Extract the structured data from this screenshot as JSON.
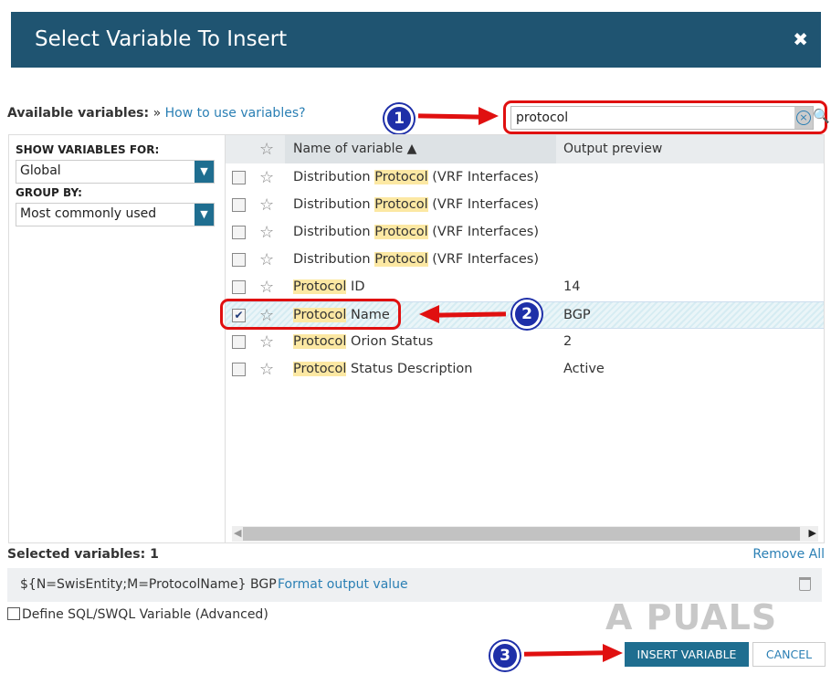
{
  "dialog": {
    "title": "Select Variable To Insert",
    "close_glyph": "✖"
  },
  "available": {
    "label": "Available variables:",
    "sep": "»",
    "help_link": "How to use variables?"
  },
  "search": {
    "value": "protocol",
    "clear_glyph": "×",
    "search_glyph": "🔍"
  },
  "filters": {
    "show_for_label": "SHOW VARIABLES FOR:",
    "show_for_value": "Global",
    "group_by_label": "GROUP BY:",
    "group_by_value": "Most commonly used",
    "dropdown_glyph": "▼"
  },
  "grid": {
    "header": {
      "name": "Name of variable ▲",
      "preview": "Output preview"
    },
    "rows": [
      {
        "pre": "Distribution ",
        "hl": "Protocol",
        "post": " (VRF Interfaces)",
        "preview": "",
        "checked": false
      },
      {
        "pre": "Distribution ",
        "hl": "Protocol",
        "post": " (VRF Interfaces)",
        "preview": "",
        "checked": false
      },
      {
        "pre": "Distribution ",
        "hl": "Protocol",
        "post": " (VRF Interfaces)",
        "preview": "",
        "checked": false
      },
      {
        "pre": "Distribution ",
        "hl": "Protocol",
        "post": " (VRF Interfaces)",
        "preview": "",
        "checked": false
      },
      {
        "pre": "",
        "hl": "Protocol",
        "post": " ID",
        "preview": "14",
        "checked": false
      },
      {
        "pre": "",
        "hl": "Protocol",
        "post": " Name",
        "preview": "BGP",
        "checked": true
      },
      {
        "pre": "",
        "hl": "Protocol",
        "post": " Orion Status",
        "preview": "2",
        "checked": false
      },
      {
        "pre": "",
        "hl": "Protocol",
        "post": " Status Description",
        "preview": "Active",
        "checked": false
      }
    ],
    "star_glyph": "☆",
    "check_glyph": "✔",
    "scroll_left": "◀",
    "scroll_right": "▶"
  },
  "selected": {
    "label": "Selected variables: 1",
    "remove_all": "Remove All",
    "expression": "${N=SwisEntity;M=ProtocolName}",
    "expression_value": "BGP",
    "format_link": "Format output value"
  },
  "define_sql": "Define SQL/SWQL Variable (Advanced)",
  "buttons": {
    "insert": "INSERT VARIABLE",
    "cancel": "CANCEL"
  },
  "annotations": [
    "1",
    "2",
    "3"
  ],
  "watermark": "A  PUALS",
  "colors": {
    "titlebar": "#1f5471",
    "accent": "#1f6e90",
    "link": "#2a7fb4",
    "highlight": "#fce8a3",
    "annotation_red": "#e01010",
    "annotation_blue": "#1e2fa8"
  }
}
